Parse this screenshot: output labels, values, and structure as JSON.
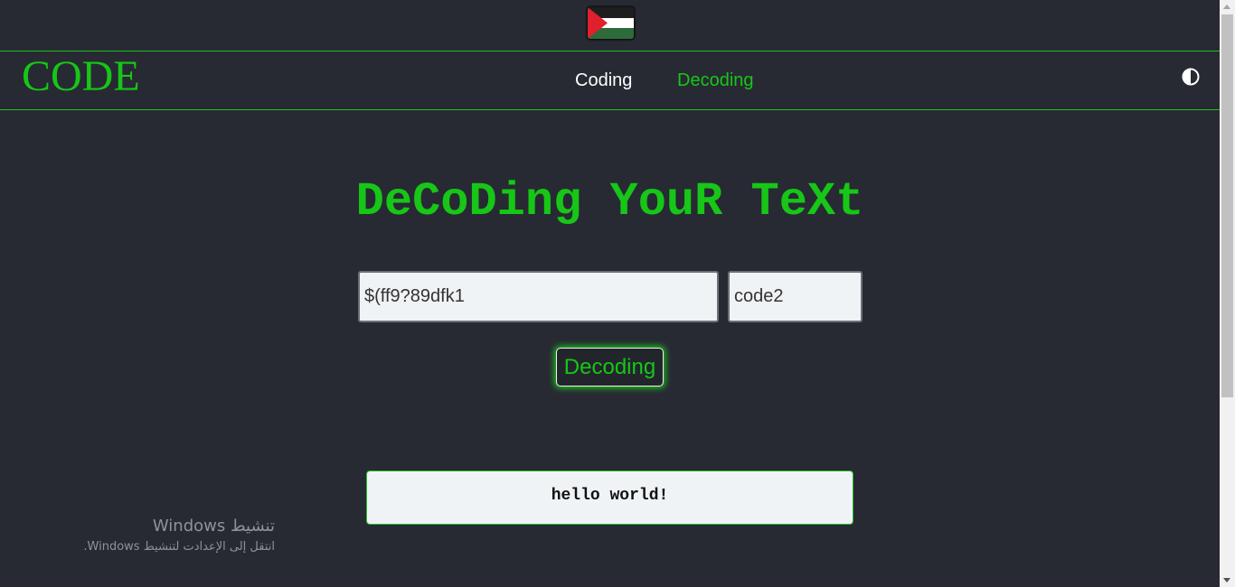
{
  "flag": {
    "icon": "palestine-flag-icon",
    "colors": {
      "black": "#1e1e1e",
      "white": "#ffffff",
      "green": "#2e6b3a",
      "red": "#e0202c"
    }
  },
  "navbar": {
    "logo": "CODE",
    "links": [
      {
        "label": "Coding",
        "active": false
      },
      {
        "label": "Decoding",
        "active": true
      }
    ],
    "theme_toggle_icon": "contrast-icon"
  },
  "main": {
    "heading": "DeCoDing YouR TeXt",
    "text_input": {
      "value": "$(ff9?89dfk1",
      "placeholder": ""
    },
    "key_input": {
      "value": "code2",
      "placeholder": ""
    },
    "decode_button": "Decoding",
    "result": "hello world!"
  },
  "os_watermark": {
    "title": "تنشيط Windows",
    "subtitle": "انتقل إلى الإعدادت لتنشيط Windows."
  },
  "colors": {
    "background": "#272a33",
    "accent": "#17c617",
    "input_bg": "#f0f3f6"
  }
}
